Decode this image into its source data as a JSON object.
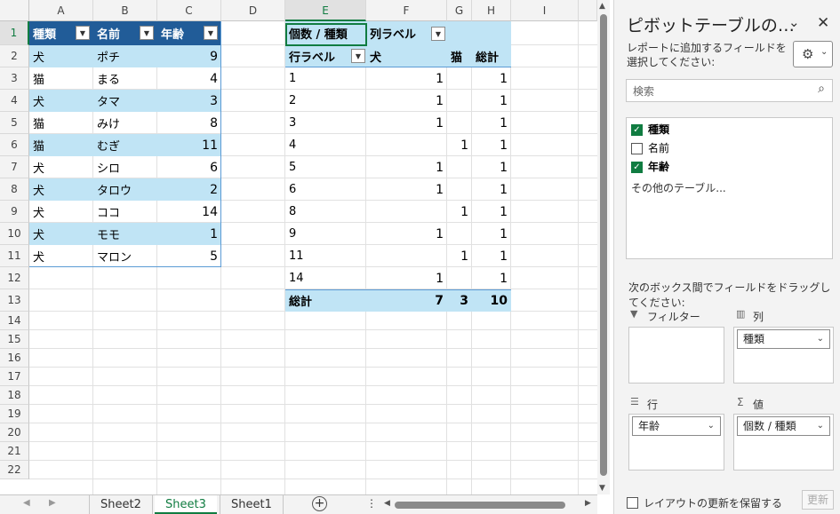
{
  "columns": [
    "A",
    "B",
    "C",
    "D",
    "E",
    "F",
    "G",
    "H",
    "I"
  ],
  "rows": [
    "1",
    "2",
    "3",
    "4",
    "5",
    "6",
    "7",
    "8",
    "9",
    "10",
    "11",
    "12",
    "13",
    "14",
    "15",
    "16",
    "17",
    "18",
    "19",
    "20",
    "21",
    "22"
  ],
  "table": {
    "headers": [
      "種類",
      "名前",
      "年齢"
    ],
    "rows": [
      [
        "犬",
        "ポチ",
        "9"
      ],
      [
        "猫",
        "まる",
        "4"
      ],
      [
        "犬",
        "タマ",
        "3"
      ],
      [
        "猫",
        "みけ",
        "8"
      ],
      [
        "猫",
        "むぎ",
        "11"
      ],
      [
        "犬",
        "シロ",
        "6"
      ],
      [
        "犬",
        "タロウ",
        "2"
      ],
      [
        "犬",
        "ココ",
        "14"
      ],
      [
        "犬",
        "モモ",
        "1"
      ],
      [
        "犬",
        "マロン",
        "5"
      ]
    ]
  },
  "pivot": {
    "corner_label": "個数 / 種類",
    "col_label": "列ラベル",
    "row_label": "行ラベル",
    "col_headers": [
      "犬",
      "猫",
      "総計"
    ],
    "rows": [
      [
        "1",
        "1",
        "",
        "1"
      ],
      [
        "2",
        "1",
        "",
        "1"
      ],
      [
        "3",
        "1",
        "",
        "1"
      ],
      [
        "4",
        "",
        "1",
        "1"
      ],
      [
        "5",
        "1",
        "",
        "1"
      ],
      [
        "6",
        "1",
        "",
        "1"
      ],
      [
        "8",
        "",
        "1",
        "1"
      ],
      [
        "9",
        "1",
        "",
        "1"
      ],
      [
        "11",
        "",
        "1",
        "1"
      ],
      [
        "14",
        "1",
        "",
        "1"
      ]
    ],
    "total": [
      "総計",
      "7",
      "3",
      "10"
    ]
  },
  "sheets": [
    "Sheet2",
    "Sheet3",
    "Sheet1"
  ],
  "active_sheet": "Sheet3",
  "pane": {
    "title": "ピボットテーブルの…",
    "instruction": "レポートに追加するフィールドを選択してください:",
    "search_placeholder": "検索",
    "fields": [
      {
        "label": "種類",
        "checked": true
      },
      {
        "label": "名前",
        "checked": false
      },
      {
        "label": "年齢",
        "checked": true
      }
    ],
    "more_tables": "その他のテーブル...",
    "drag_hint": "次のボックス間でフィールドをドラッグしてください:",
    "filter_label": "フィルター",
    "columns_label": "列",
    "columns_value": "種類",
    "rows_label": "行",
    "rows_value": "年齢",
    "values_label": "値",
    "values_value": "個数 / 種類",
    "defer_label": "レイアウトの更新を保留する",
    "update_label": "更新"
  },
  "colors": {
    "accent": "#107c41",
    "table_header": "#215c98",
    "band": "#c0e4f5"
  }
}
